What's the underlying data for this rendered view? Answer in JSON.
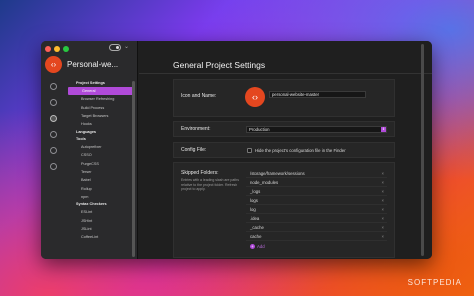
{
  "window": {
    "project_name": "Personal-we..."
  },
  "sidebar": {
    "sections": [
      {
        "title": "Project Settings",
        "items": [
          "General",
          "Browser Refreshing",
          "Build Process",
          "Target Browsers",
          "Hooks"
        ],
        "selected_index": 0
      },
      {
        "title": "Languages",
        "items": []
      },
      {
        "title": "Tools",
        "items": [
          "Autoprefixer",
          "CSSO",
          "PurgeCSS",
          "Terser",
          "Babel",
          "Rollup",
          "npm"
        ]
      },
      {
        "title": "Syntax Checkers",
        "items": [
          "ESLint",
          "JSHint",
          "JSLint",
          "CoffeeLint"
        ]
      }
    ],
    "rail_icons": [
      "project-icon",
      "folder-icon",
      "settings-icon",
      "layers-icon",
      "list-icon",
      "globe-icon"
    ]
  },
  "main": {
    "title": "General Project Settings",
    "icon_and_name": {
      "label": "Icon and Name:",
      "icon_glyph": "‹›",
      "project_name": "personal-website-master"
    },
    "environment": {
      "label": "Environment:",
      "value": "Production"
    },
    "config_file": {
      "label": "Config File:",
      "checkbox_label": "Hide the project's configuration file in the Finder"
    },
    "skipped_folders": {
      "label": "Skipped Folders:",
      "help": "Entries with a leading slash are paths relative to the project folder. Refresh project to apply.",
      "folders": [
        "/storage/framework/sessions",
        "node_modules",
        "_logs",
        "logs",
        "log",
        ".idea",
        "_cache",
        "cache"
      ],
      "remove_glyph": "×",
      "add_label": "Add"
    }
  },
  "watermark": "SOFTPEDIA",
  "colors": {
    "accent": "#b04ad9",
    "project_icon": "#e4471f",
    "window_bg": "#1f1f1f",
    "sidebar_bg": "#2a2a2c"
  }
}
